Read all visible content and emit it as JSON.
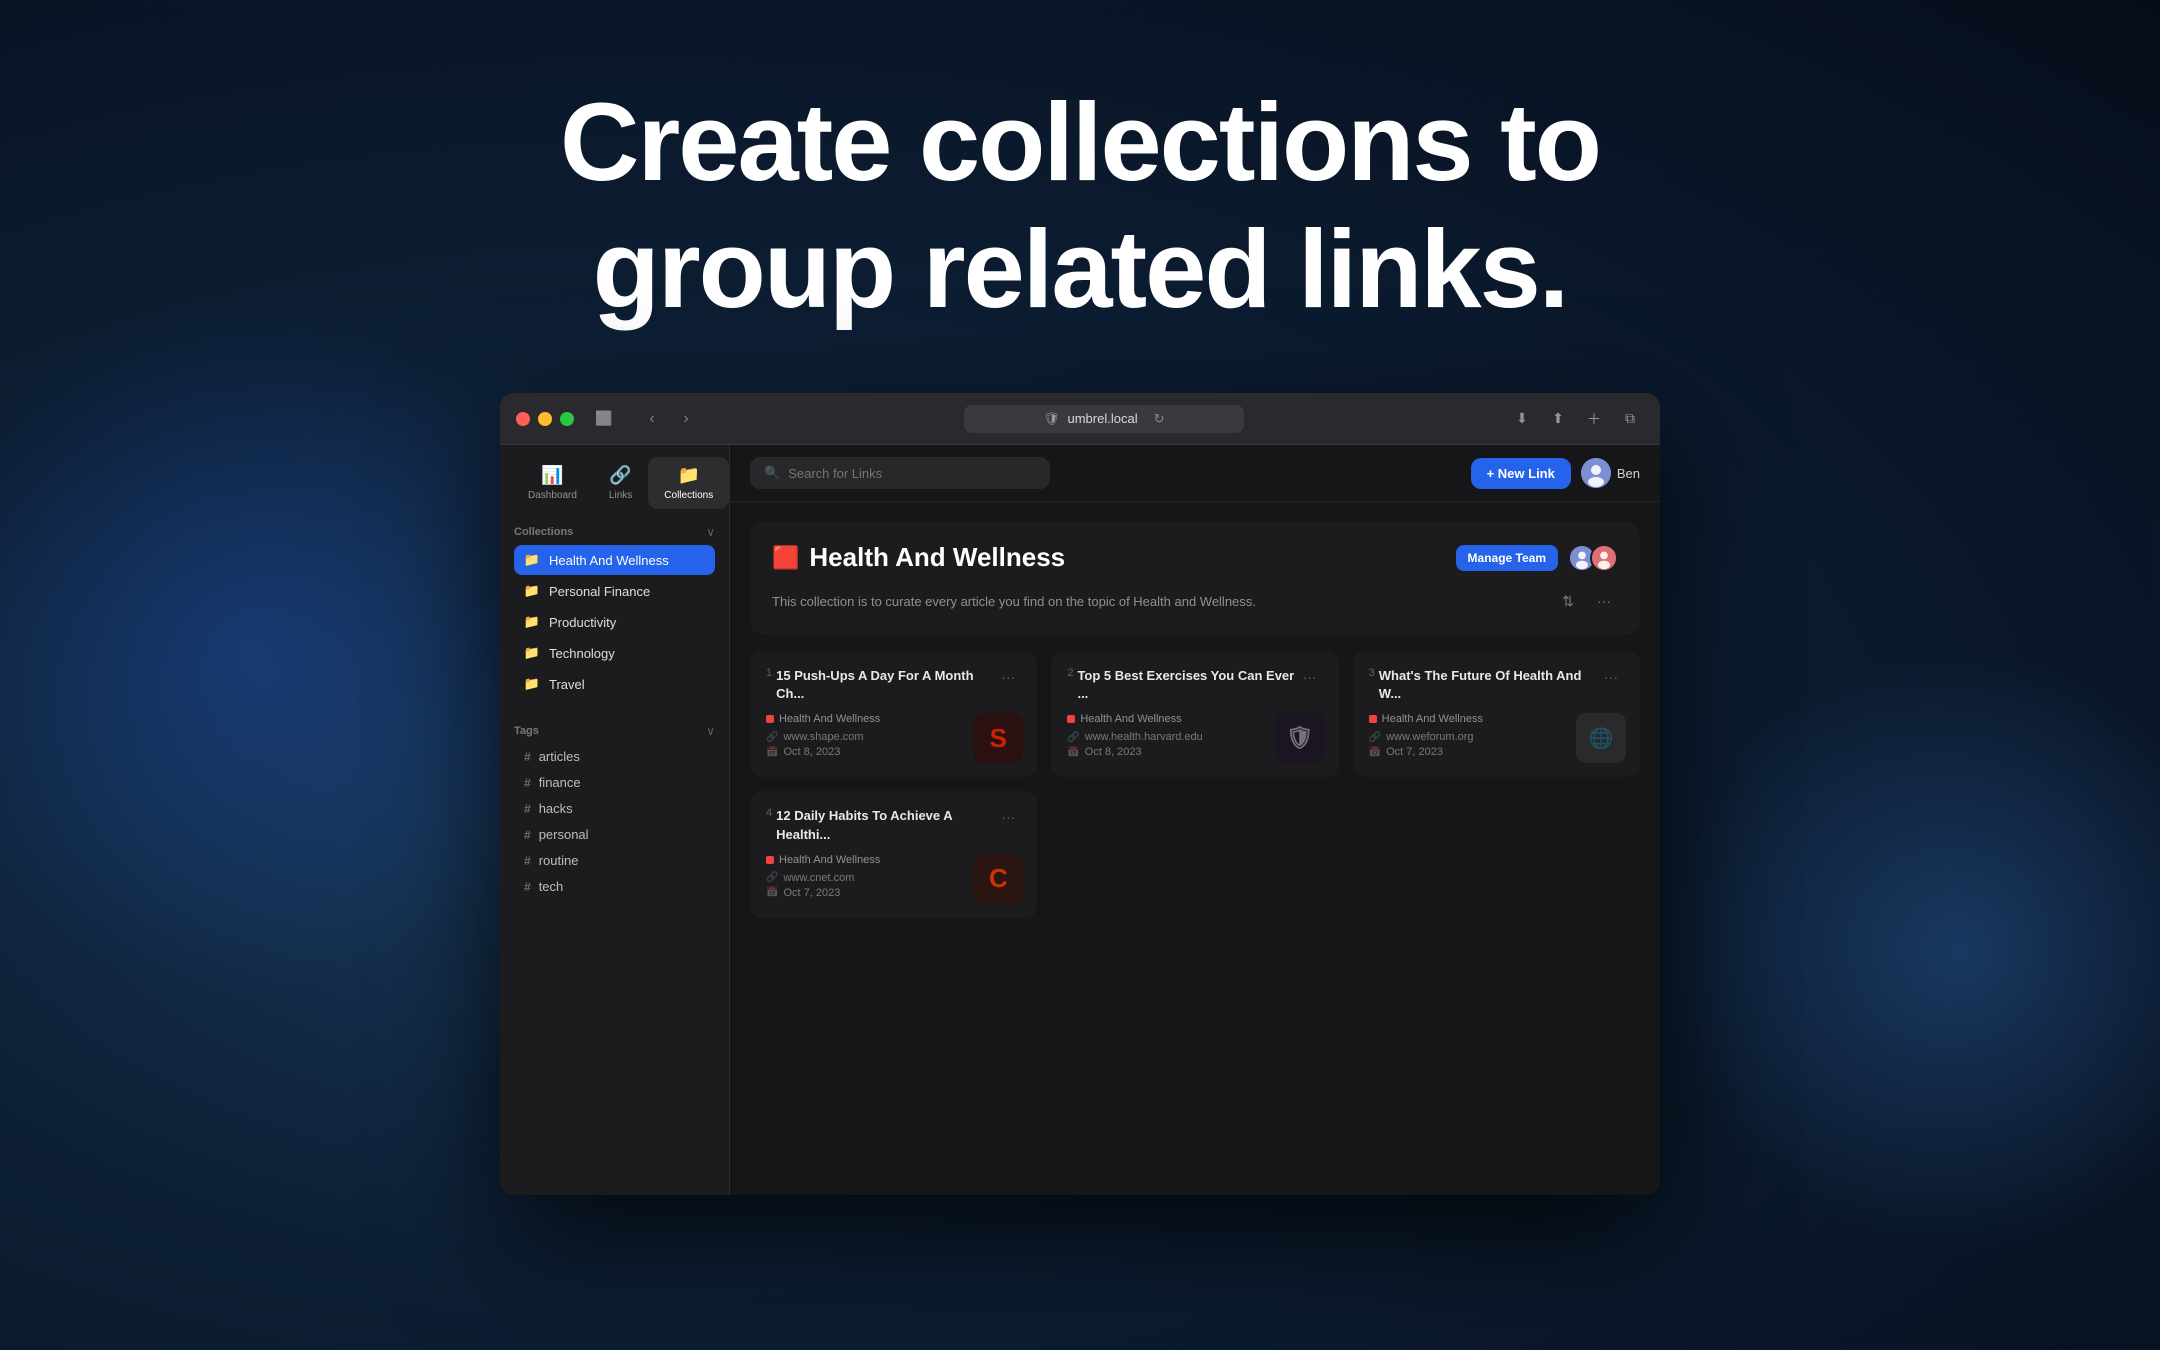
{
  "hero": {
    "line1": "Create collections to",
    "line2": "group related links."
  },
  "browser": {
    "url": "umbrel.local",
    "reload_icon": "↻"
  },
  "nav_tabs": [
    {
      "id": "dashboard",
      "label": "Dashboard",
      "icon": "📊",
      "active": false
    },
    {
      "id": "links",
      "label": "Links",
      "icon": "🔗",
      "active": false
    },
    {
      "id": "collections",
      "label": "Collections",
      "icon": "📁",
      "active": true
    }
  ],
  "sidebar": {
    "collections_section": {
      "title": "Collections",
      "items": [
        {
          "id": "health-and-wellness",
          "label": "Health And Wellness",
          "color": "#ef4444",
          "active": true
        },
        {
          "id": "personal-finance",
          "label": "Personal Finance",
          "color": "#22c55e",
          "active": false
        },
        {
          "id": "productivity",
          "label": "Productivity",
          "color": "#a855f7",
          "active": false
        },
        {
          "id": "technology",
          "label": "Technology",
          "color": "#3b82f6",
          "active": false
        },
        {
          "id": "travel",
          "label": "Travel",
          "color": "#eab308",
          "active": false
        }
      ]
    },
    "tags_section": {
      "title": "Tags",
      "items": [
        {
          "id": "articles",
          "label": "articles"
        },
        {
          "id": "finance",
          "label": "finance"
        },
        {
          "id": "hacks",
          "label": "hacks"
        },
        {
          "id": "personal",
          "label": "personal"
        },
        {
          "id": "routine",
          "label": "routine"
        },
        {
          "id": "tech",
          "label": "tech"
        }
      ]
    }
  },
  "toolbar": {
    "search_placeholder": "Search for Links",
    "new_link_label": "+ New Link",
    "user_name": "Ben"
  },
  "collection": {
    "title": "Health And Wellness",
    "emoji": "🟥",
    "description": "This collection is to curate every article you find on the topic of Health and Wellness.",
    "manage_team_label": "Manage Team",
    "team_members": [
      "A",
      "B"
    ],
    "links": [
      {
        "number": "1",
        "title": "15 Push-Ups A Day For A Month Ch...",
        "collection": "Health And Wellness",
        "url": "www.shape.com",
        "date": "Oct 8, 2023",
        "thumb_text": "S",
        "thumb_class": "thumb-s"
      },
      {
        "number": "2",
        "title": "Top 5 Best Exercises You Can Ever ...",
        "collection": "Health And Wellness",
        "url": "www.health.harvard.edu",
        "date": "Oct 8, 2023",
        "thumb_text": "🛡",
        "thumb_class": "thumb-harvard"
      },
      {
        "number": "3",
        "title": "What's The Future Of Health And W...",
        "collection": "Health And Wellness",
        "url": "www.weforum.org",
        "date": "Oct 7, 2023",
        "thumb_text": "⬜",
        "thumb_class": "thumb-weforum"
      },
      {
        "number": "4",
        "title": "12 Daily Habits To Achieve A Healthi...",
        "collection": "Health And Wellness",
        "url": "www.cnet.com",
        "date": "Oct 7, 2023",
        "thumb_text": "C",
        "thumb_class": "thumb-cnet"
      }
    ]
  }
}
